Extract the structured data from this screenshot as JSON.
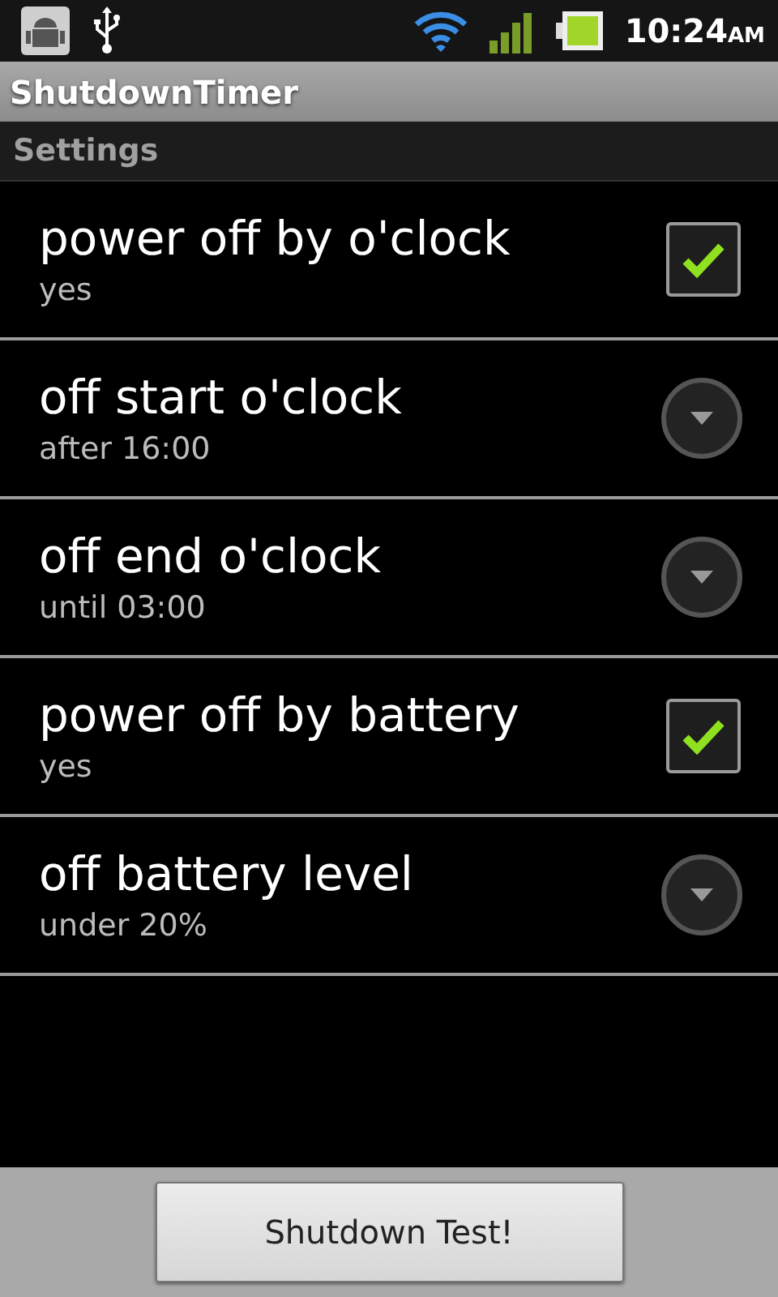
{
  "status_bar": {
    "time": "10:24",
    "ampm": "AM"
  },
  "title": "ShutdownTimer",
  "section": "Settings",
  "preferences": [
    {
      "kind": "checkbox",
      "title": "power off by o'clock",
      "summary": "yes",
      "checked": true
    },
    {
      "kind": "dropdown",
      "title": "off start o'clock",
      "summary": "after 16:00"
    },
    {
      "kind": "dropdown",
      "title": "off end o'clock",
      "summary": "until 03:00"
    },
    {
      "kind": "checkbox",
      "title": "power off by battery",
      "summary": "yes",
      "checked": true
    },
    {
      "kind": "dropdown",
      "title": "off battery level",
      "summary": "under 20%"
    }
  ],
  "button": "Shutdown Test!"
}
